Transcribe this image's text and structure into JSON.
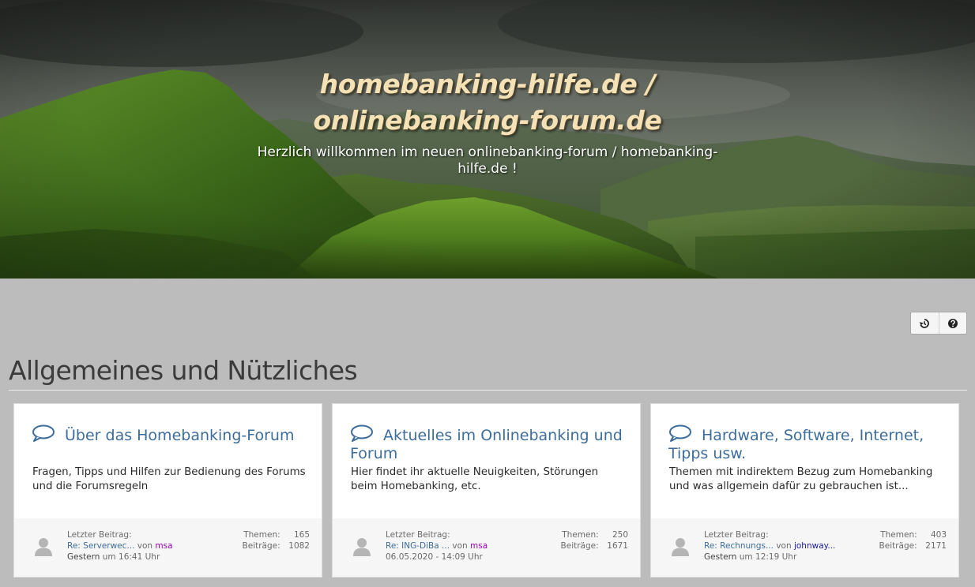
{
  "hero": {
    "title_line1": "homebanking-hilfe.de /",
    "title_line2": "onlinebanking-forum.de",
    "subtitle": "Herzlich willkommen im neuen onlinebanking-forum / homebanking-hilfe.de !"
  },
  "toolbar": {
    "buttons": [
      {
        "icon": "history-icon"
      },
      {
        "icon": "help-icon"
      }
    ]
  },
  "section": {
    "title": "Allgemeines und Nützliches"
  },
  "labels": {
    "last_post": "Letzter Beitrag:",
    "by": "von",
    "at": "um",
    "topics": "Themen:",
    "posts": "Beiträge:"
  },
  "forums": [
    {
      "title": "Über das Homebanking-Forum",
      "description": "Fragen, Tipps und Hilfen zur Bedienung des Forums und die Forumsregeln",
      "last_post_title": "Re: Serverwec...",
      "last_post_user": "msa",
      "user_color": "#9a00b8",
      "date_day": "Gestern",
      "date_time": "16:41 Uhr",
      "topics": "165",
      "posts": "1082"
    },
    {
      "title": "Aktuelles im Onlinebanking und Forum",
      "description": "Hier findet ihr aktuelle Neuigkeiten, Störungen beim Homebanking, etc.",
      "last_post_title": "Re: ING-DiBa ...",
      "last_post_user": "msa",
      "user_color": "#9a00b8",
      "date_full": "06.05.2020 - 14:09 Uhr",
      "topics": "250",
      "posts": "1671"
    },
    {
      "title": "Hardware, Software, Internet, Tipps usw.",
      "description": "Themen mit indirektem Bezug zum Homebanking und was allgemein dafür zu gebrauchen ist...",
      "last_post_title": "Re: Rechnungs...",
      "last_post_user": "johnway...",
      "user_color": "#1a1aa8",
      "date_day": "Gestern",
      "date_time": "12:19 Uhr",
      "topics": "403",
      "posts": "2171"
    }
  ]
}
